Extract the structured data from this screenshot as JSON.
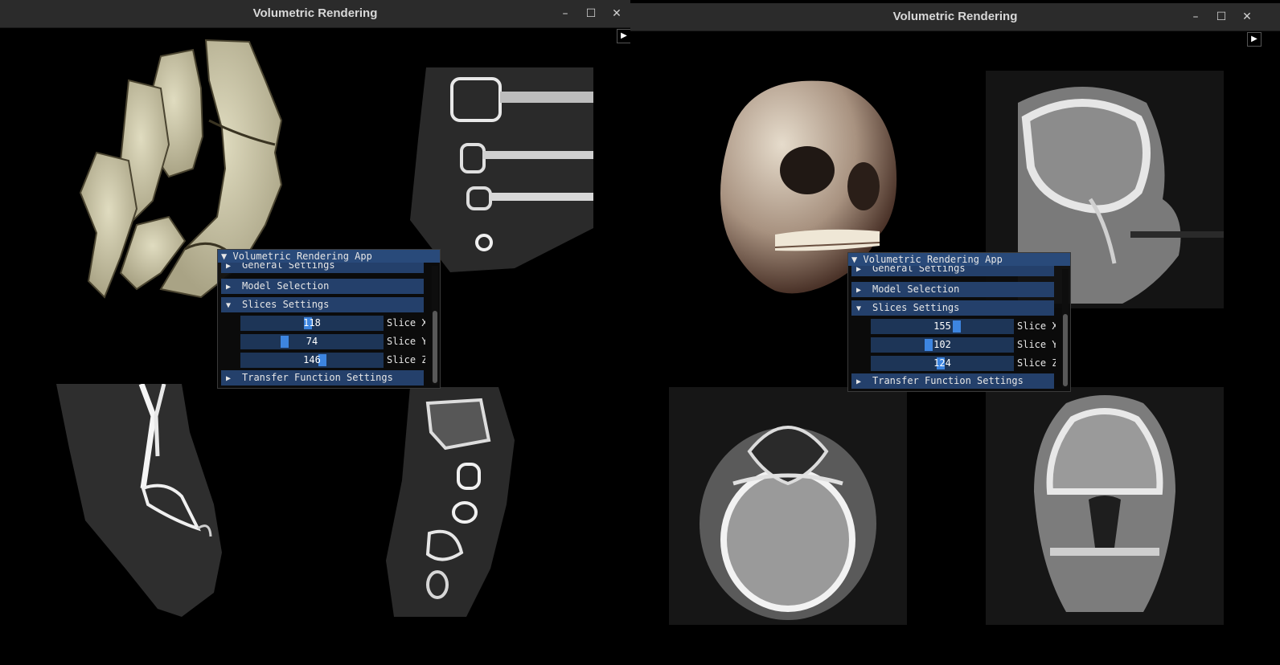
{
  "windows": [
    {
      "title": "Volumetric Rendering",
      "controls": {
        "minimize": "–",
        "maximize": "☐",
        "close": "✕"
      },
      "play": "▶",
      "panel": {
        "title": "Volumetric Rendering App",
        "title_arrow": "▼",
        "headers": {
          "general": "General Settings",
          "model": "Model Selection",
          "slices": "Slices Settings",
          "transfer": "Transfer Function Settings"
        },
        "arrows": {
          "collapsed": "▶",
          "expanded": "▼"
        },
        "sliders": [
          {
            "label": "Slice X",
            "value": "118",
            "fraction": 0.47
          },
          {
            "label": "Slice Y",
            "value": "74",
            "fraction": 0.3
          },
          {
            "label": "Slice Z",
            "value": "146",
            "fraction": 0.58
          }
        ]
      }
    },
    {
      "title": "Volumetric Rendering",
      "controls": {
        "minimize": "–",
        "maximize": "☐",
        "close": "✕"
      },
      "play": "▶",
      "panel": {
        "title": "Volumetric Rendering App",
        "title_arrow": "▼",
        "headers": {
          "general": "General Settings",
          "model": "Model Selection",
          "slices": "Slices Settings",
          "transfer": "Transfer Function Settings"
        },
        "arrows": {
          "collapsed": "▶",
          "expanded": "▼"
        },
        "sliders": [
          {
            "label": "Slice X",
            "value": "155",
            "fraction": 0.61
          },
          {
            "label": "Slice Y",
            "value": "102",
            "fraction": 0.4
          },
          {
            "label": "Slice Z",
            "value": "124",
            "fraction": 0.49
          }
        ]
      }
    }
  ],
  "colors": {
    "titlebar": "#2b2b2b",
    "panel_title": "#294a7a",
    "panel_header": "#24406b",
    "slider_bg": "#1d3557",
    "slider_grab": "#3d85e0",
    "bone_foot": "#cdc8a8",
    "bone_skull": "#d8cfb8"
  },
  "icons": {
    "minimize": "minimize-icon",
    "maximize": "maximize-icon",
    "close": "close-icon",
    "play": "play-icon",
    "collapse": "collapse-arrow-icon"
  }
}
